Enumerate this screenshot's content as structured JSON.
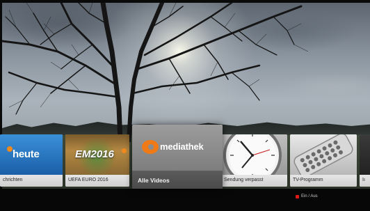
{
  "tiles": [
    {
      "label": "chrichten",
      "logo_text": "heute",
      "icon": "heute-logo-icon"
    },
    {
      "label": "UEFA EURO 2016",
      "logo_text": "EM2016",
      "icon": "em2016-logo-icon"
    },
    {
      "label": "Alle Videos",
      "logo_text": "mediathek",
      "icon": "zdf-mediathek-logo-icon",
      "focused": true
    },
    {
      "label": "Sendung verpasst",
      "icon": "clock-icon"
    },
    {
      "label": "TV-Programm",
      "icon": "remote-control-icon"
    },
    {
      "label": "Iı",
      "icon": "more-tile-icon"
    }
  ],
  "footer": {
    "toggle_label": "Ein / Aus",
    "toggle_color": "#e01818"
  },
  "colors": {
    "zdf_orange": "#f07a18",
    "focus_tile": "#5c5c5c"
  }
}
